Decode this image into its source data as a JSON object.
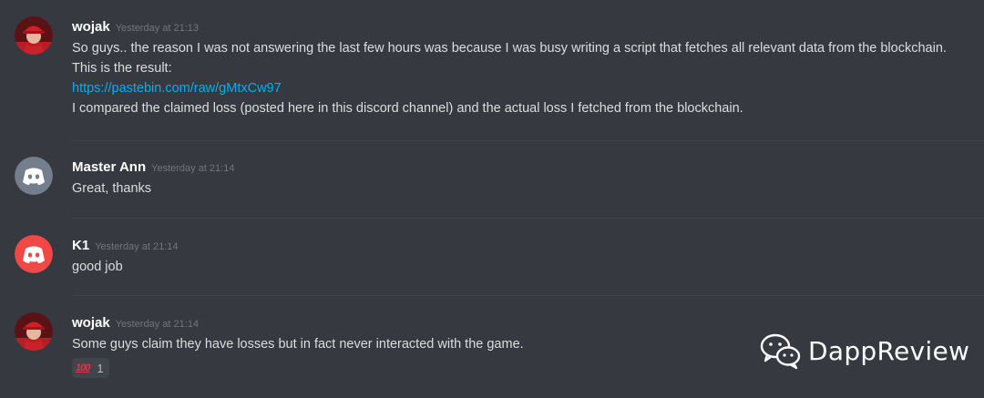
{
  "messages": [
    {
      "username": "wojak",
      "timestamp": "Yesterday at 21:13",
      "lines": [
        "So guys.. the reason I was not answering the last few hours was because I was busy writing a script that fetches all relevant data from the blockchain.",
        "This is the result:",
        "https://pastebin.com/raw/gMtxCw97",
        "I compared the claimed loss (posted here in this discord channel) and the actual loss I fetched from the blockchain."
      ]
    },
    {
      "username": "Master Ann",
      "timestamp": "Yesterday at 21:14",
      "lines": [
        "Great, thanks"
      ]
    },
    {
      "username": "K1",
      "timestamp": "Yesterday at 21:14",
      "lines": [
        "good job"
      ]
    },
    {
      "username": "wojak",
      "timestamp": "Yesterday at 21:14",
      "lines": [
        "Some guys claim they have losses but in fact never interacted with the game."
      ],
      "reaction": {
        "emoji": "100",
        "count": "1"
      }
    }
  ],
  "colors": {
    "background": "#36393f",
    "username": "#ffffff",
    "timestamp": "#72767d",
    "text": "#dcddde",
    "link": "#00b0f4",
    "avatar_gray": "#747f8d",
    "avatar_red": "#f04747"
  },
  "icons": {
    "avatar_wojak": "red-cap-person-avatar-icon",
    "avatar_master_ann": "discord-logo-icon",
    "avatar_k1": "discord-logo-icon",
    "reaction": "hundred-points-emoji-icon",
    "watermark": "wechat-icon"
  },
  "watermark": {
    "text": "DappReview"
  }
}
